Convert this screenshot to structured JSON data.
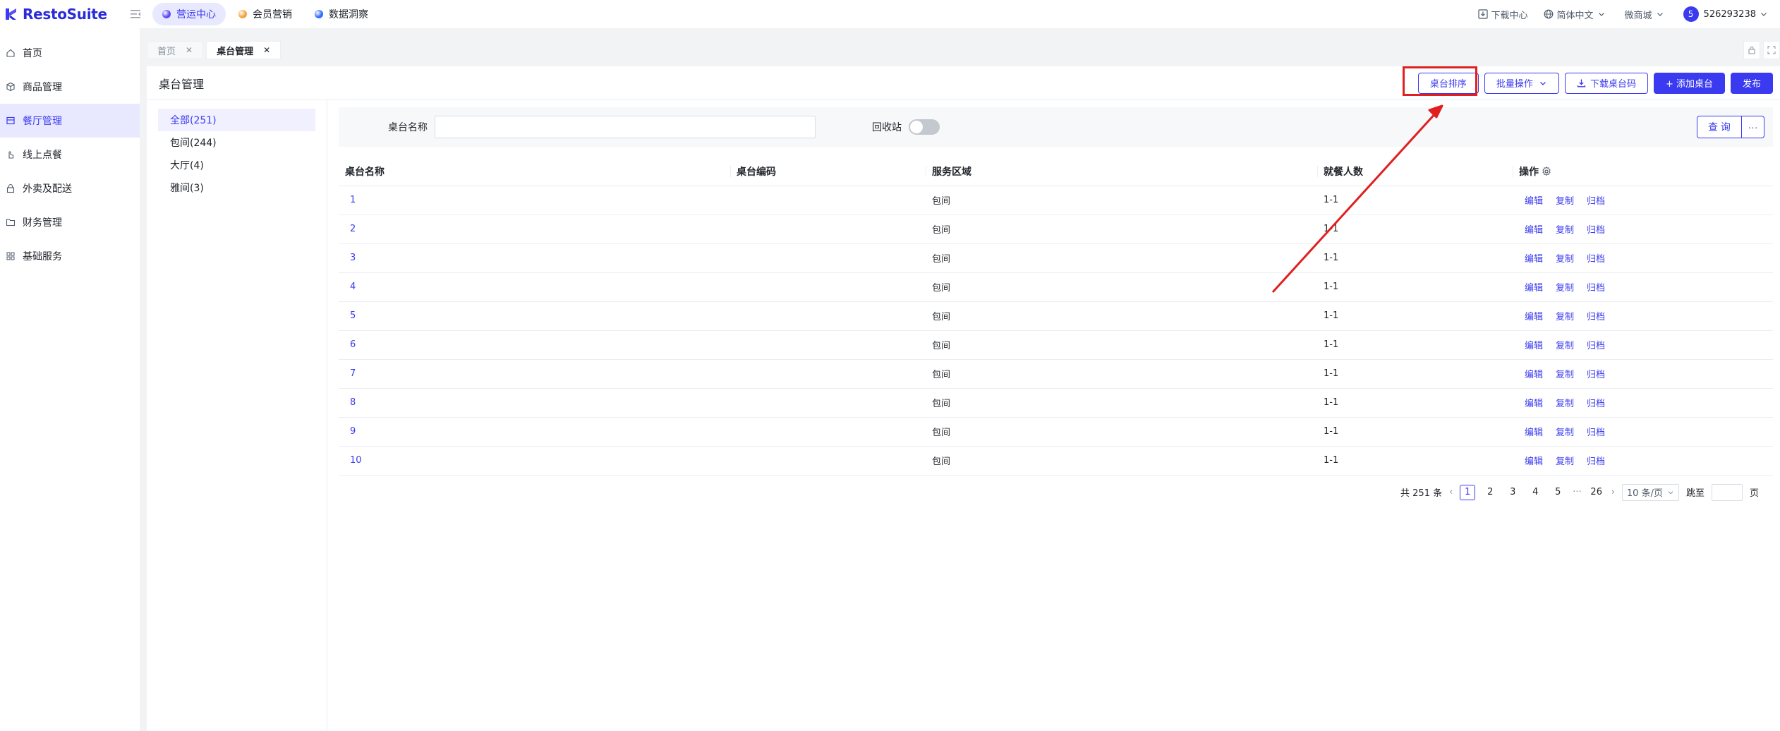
{
  "app": {
    "logo_text": "RestoSuite",
    "brand_color": "#3a3af0",
    "highlight_color": "#e02020"
  },
  "topnav": [
    {
      "label": "营运中心",
      "icon": "ops-center-icon",
      "color": "#5a4cf5",
      "active": true
    },
    {
      "label": "会员营销",
      "icon": "member-marketing-icon",
      "color": "#f2a33a",
      "active": false
    },
    {
      "label": "数据洞察",
      "icon": "data-insight-icon",
      "color": "#2f6bff",
      "active": false
    }
  ],
  "topright": {
    "download_center": "下载中心",
    "language": "简体中文",
    "mall": "微商城",
    "avatar_letter": "5",
    "user_id": "526293238"
  },
  "sidebar": [
    {
      "label": "首页",
      "icon": "home-icon",
      "active": false
    },
    {
      "label": "商品管理",
      "icon": "cube-icon",
      "active": false
    },
    {
      "label": "餐厅管理",
      "icon": "restaurant-icon",
      "active": true
    },
    {
      "label": "线上点餐",
      "icon": "hand-icon",
      "active": false
    },
    {
      "label": "外卖及配送",
      "icon": "lock-bag-icon",
      "active": false
    },
    {
      "label": "财务管理",
      "icon": "folder-icon",
      "active": false
    },
    {
      "label": "基础服务",
      "icon": "grid-icon",
      "active": false
    }
  ],
  "tabs": [
    {
      "label": "首页",
      "active": false
    },
    {
      "label": "桌台管理",
      "active": true
    }
  ],
  "page": {
    "title": "桌台管理",
    "actions": {
      "sort": "桌台排序",
      "batch": "批量操作",
      "download_qr": "下载桌台码",
      "add": "+ 添加桌台",
      "publish": "发布"
    }
  },
  "categories": [
    {
      "label": "全部(251)",
      "active": true
    },
    {
      "label": "包间(244)",
      "active": false
    },
    {
      "label": "大厅(4)",
      "active": false
    },
    {
      "label": "雅间(3)",
      "active": false
    }
  ],
  "filter": {
    "name_label": "桌台名称",
    "name_value": "",
    "recycle_label": "回收站",
    "recycle_on": false,
    "query": "查 询",
    "more": "···"
  },
  "table": {
    "headers": [
      "桌台名称",
      "桌台编码",
      "服务区域",
      "就餐人数",
      "操作"
    ],
    "ops": [
      "编辑",
      "复制",
      "归档"
    ],
    "rows": [
      [
        "1",
        "",
        "包间",
        "1-1"
      ],
      [
        "2",
        "",
        "包间",
        "1-1"
      ],
      [
        "3",
        "",
        "包间",
        "1-1"
      ],
      [
        "4",
        "",
        "包间",
        "1-1"
      ],
      [
        "5",
        "",
        "包间",
        "1-1"
      ],
      [
        "6",
        "",
        "包间",
        "1-1"
      ],
      [
        "7",
        "",
        "包间",
        "1-1"
      ],
      [
        "8",
        "",
        "包间",
        "1-1"
      ],
      [
        "9",
        "",
        "包间",
        "1-1"
      ],
      [
        "10",
        "",
        "包间",
        "1-1"
      ]
    ]
  },
  "pagination": {
    "total": "共 251 条",
    "pages": [
      "1",
      "2",
      "3",
      "4",
      "5"
    ],
    "ellipsis": "···",
    "last": "26",
    "active": "1",
    "page_size": "10 条/页",
    "jump_label": "跳至",
    "page_unit": "页"
  }
}
